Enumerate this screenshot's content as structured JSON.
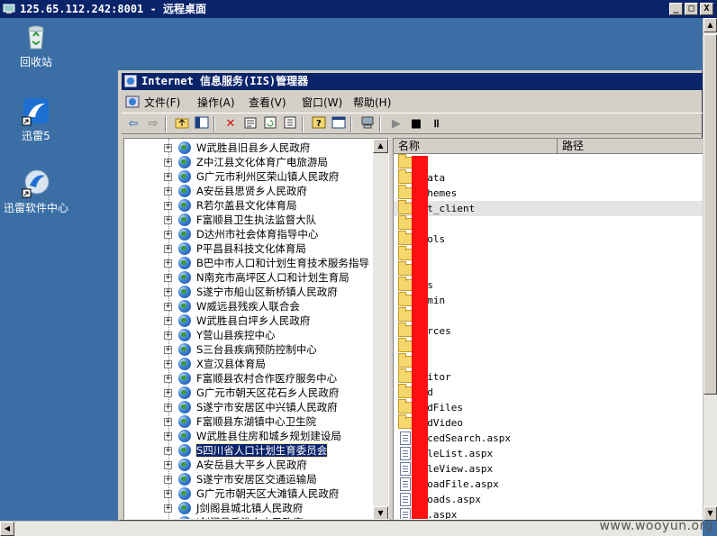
{
  "remote_desktop": {
    "title": "125.65.112.242:8001 - 远程桌面",
    "btn_minimize": "_",
    "btn_restore": "□",
    "btn_close": "X"
  },
  "desktop_icons": [
    {
      "label": "回收站",
      "icon": "recycle-bin-icon"
    },
    {
      "label": "迅雷5",
      "icon": "thunder-icon"
    },
    {
      "label": "迅雷软件中心",
      "icon": "thunder-center-icon"
    }
  ],
  "iis": {
    "title": "Internet 信息服务(IIS)管理器",
    "menu": [
      "文件(F)",
      "操作(A)",
      "查看(V)",
      "窗口(W)",
      "帮助(H)"
    ],
    "toolbar": [
      "back-icon",
      "forward-icon",
      "up-folder-icon",
      "show-tree-icon",
      "delete-icon",
      "properties-icon",
      "refresh-icon",
      "export-icon",
      "help-icon",
      "console-icon",
      "computer-icon",
      "play-icon",
      "stop-icon",
      "pause-icon"
    ]
  },
  "tree": {
    "items": [
      "W武胜县旧县乡人民政府",
      "Z中江县文化体育广电旅游局",
      "G广元市利州区荣山镇人民政府",
      "A安岳县思贤乡人民政府",
      "R若尔盖县文化体育局",
      "F富顺县卫生执法监督大队",
      "D达州市社会体育指导中心",
      "P平昌县科技文化体育局",
      "B巴中市人口和计划生育技术服务指导",
      "N南充市高坪区人口和计划生育局",
      "S遂宁市船山区新桥镇人民政府",
      "W威远县残疾人联合会",
      "W武胜县白坪乡人民政府",
      "Y营山县疾控中心",
      "S三台县疾病预防控制中心",
      "X宣汉县体育局",
      "F富顺县农村合作医疗服务中心",
      "G广元市朝天区花石乡人民政府",
      "S遂宁市安居区中兴镇人民政府",
      "F富顺县东湖镇中心卫生院",
      "W武胜县住房和城乡规划建设局",
      "S四川省人口计划生育委员会",
      "A安岳县大平乡人民政府",
      "S遂宁市安居区交通运输局",
      "G广元市朝天区大滩镇人民政府",
      "J剑阁县城北镇人民政府",
      "J剑阁县香淮乡人民政府"
    ],
    "selected_index": 21
  },
  "list": {
    "columns": [
      "名称",
      "路径"
    ],
    "items": [
      {
        "name": "in",
        "type": "folder"
      },
      {
        "name": "_Data",
        "type": "folder"
      },
      {
        "name": "_Themes",
        "type": "folder"
      },
      {
        "name": "net_client",
        "type": "folder"
      },
      {
        "name": "",
        "type": "folder"
      },
      {
        "name": "trols",
        "type": "folder"
      },
      {
        "name": "",
        "type": "folder"
      },
      {
        "name": "us",
        "type": "folder"
      },
      {
        "name": "ges",
        "type": "folder"
      },
      {
        "name": "Admin",
        "type": "folder"
      },
      {
        "name": "",
        "type": "folder"
      },
      {
        "name": "ources",
        "type": "folder"
      },
      {
        "name": "",
        "type": "folder"
      },
      {
        "name": "ls",
        "type": "folder"
      },
      {
        "name": "Editor",
        "type": "folder"
      },
      {
        "name": "oad",
        "type": "folder"
      },
      {
        "name": "oadFiles",
        "type": "folder"
      },
      {
        "name": "oadVideo",
        "type": "folder"
      },
      {
        "name": "ancedSearch.aspx",
        "type": "file"
      },
      {
        "name": "icleList.aspx",
        "type": "file"
      },
      {
        "name": "icleView.aspx",
        "type": "file"
      },
      {
        "name": "nloadFile.aspx",
        "type": "file"
      },
      {
        "name": "nloads.aspx",
        "type": "file"
      },
      {
        "name": "or.aspx",
        "type": "file"
      }
    ],
    "highlighted_index": 3
  },
  "watermark": "www.wooyun.org"
}
